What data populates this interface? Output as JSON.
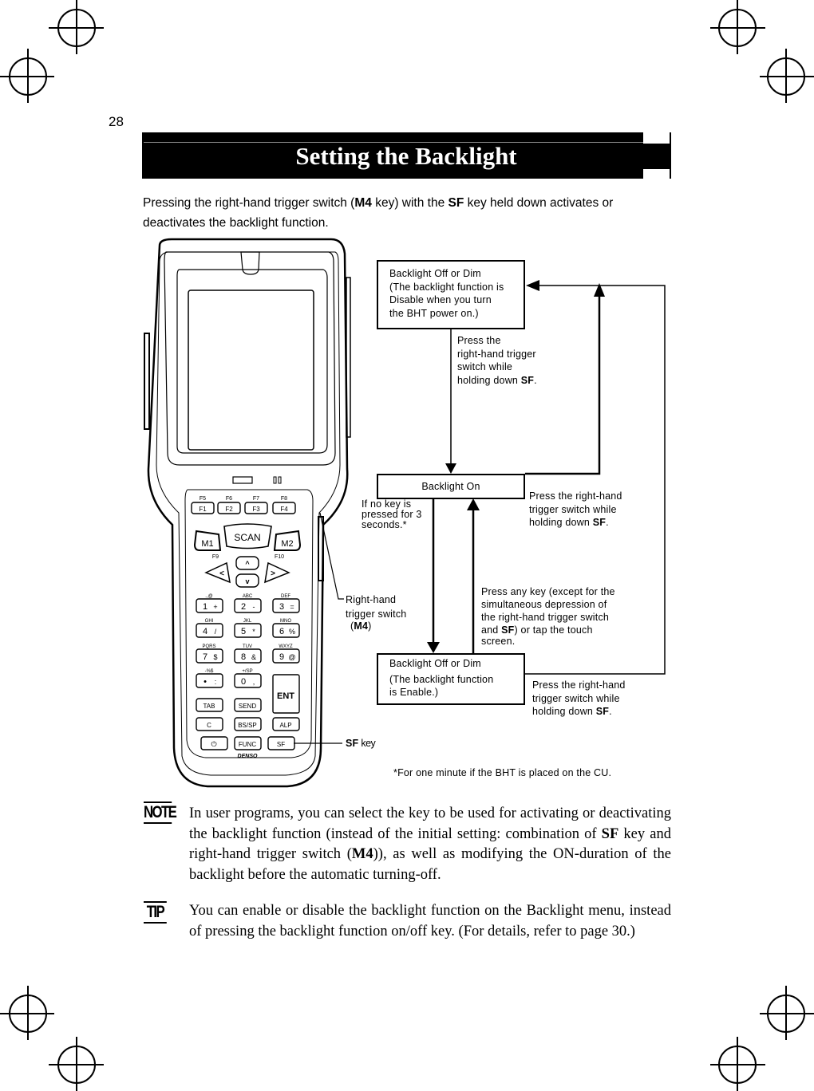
{
  "page": {
    "number": "28",
    "title": "Setting the Backlight",
    "intro": {
      "part1": "Pressing the right-hand trigger switch (",
      "key1": "M4",
      "part2": " key) with the ",
      "key2": "SF",
      "part3": " key  held down activates or deactivates the backlight function."
    }
  },
  "device": {
    "brand": "DENSO",
    "fkeys_top": [
      "F5",
      "F6",
      "F7",
      "F8"
    ],
    "fkeys": [
      "F1",
      "F2",
      "F3",
      "F4"
    ],
    "scan_label": "SCAN",
    "m1": "M1",
    "m2": "M2",
    "f9": "F9",
    "f10": "F10",
    "arrows": {
      "left": "<",
      "up": "^",
      "down": "v",
      "right": ">"
    },
    "numkeys": [
      {
        "top": ".,@",
        "main": "1",
        "alt": "+"
      },
      {
        "top": "ABC",
        "main": "2",
        "alt": "-"
      },
      {
        "top": "DEF",
        "main": "3",
        "alt": "="
      },
      {
        "top": "GHI",
        "main": "4",
        "alt": "/"
      },
      {
        "top": "JKL",
        "main": "5",
        "alt": "*"
      },
      {
        "top": "MNO",
        "main": "6",
        "alt": "%"
      },
      {
        "top": "PQRS",
        "main": "7",
        "alt": "$"
      },
      {
        "top": "TUV",
        "main": "8",
        "alt": "&"
      },
      {
        "top": "WXYZ",
        "main": "9",
        "alt": "@"
      },
      {
        "top": "-%$",
        "main": "•",
        "alt": ":"
      },
      {
        "top": "+/SP",
        "main": "0",
        "alt": ","
      }
    ],
    "ent": "ENT",
    "row_keys": [
      "TAB",
      "SEND",
      "C",
      "BS/SP",
      "ALP"
    ],
    "bottom_keys": [
      "⏻",
      "FUNC",
      "SF"
    ]
  },
  "callouts": {
    "trigger_line1": "Right-hand",
    "trigger_line2": "trigger switch",
    "trigger_key": "M4",
    "sf_key": "SF",
    "sf_suffix": " key"
  },
  "diagram": {
    "state1": {
      "title": "Backlight Off or Dim",
      "lines": [
        "(The backlight function is",
        "Disable when you turn",
        "the BHT power on.)"
      ]
    },
    "state2": {
      "title": "Backlight On"
    },
    "state3": {
      "title": "Backlight Off or Dim",
      "lines": [
        "(The backlight function",
        "is Enable.)"
      ]
    },
    "t1": {
      "lines": [
        "Press the",
        "right-hand trigger",
        "switch while"
      ],
      "last": "holding down ",
      "key": "SF",
      "end": "."
    },
    "t2": {
      "lines": [
        "Press the right-hand",
        "trigger switch while"
      ],
      "last": "holding down ",
      "key": "SF",
      "end": "."
    },
    "t3": {
      "lines": [
        "If no key is",
        "pressed for 3",
        "seconds.*"
      ]
    },
    "t4": {
      "l1": "Press any key (except for the",
      "l2": "simultaneous depression of",
      "l3": "the right-hand trigger switch",
      "l4a": "and ",
      "key": "SF",
      "l4b": ") or tap the touch",
      "l5": "screen."
    },
    "t5": {
      "lines": [
        "Press the right-hand",
        "trigger switch while"
      ],
      "last": "holding down ",
      "key": "SF",
      "end": "."
    },
    "footnote": "*For one minute if the BHT is placed on the CU."
  },
  "note": {
    "icon": "NOTE",
    "p1": "In user programs, you can select the key to be used for activating or deactivating the backlight function (instead of the initial setting: combination of ",
    "k1": "SF",
    "p2": " key and right-hand trigger switch (",
    "k2": "M4",
    "p3": ")), as well as modifying the ON-duration of the backlight before the automatic turning-off."
  },
  "tip": {
    "icon": "TIP",
    "text": "You can enable or disable the backlight function on the Backlight menu, instead of pressing the backlight function on/off key. (For details, refer to page 30.)"
  }
}
